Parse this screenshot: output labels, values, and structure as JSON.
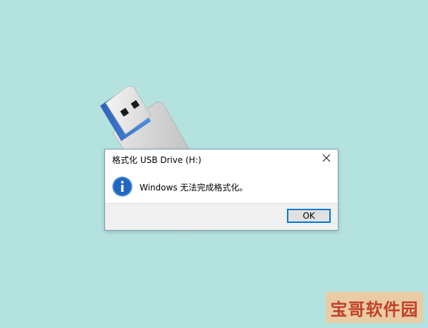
{
  "dialog": {
    "title": "格式化 USB Drive (H:)",
    "message": "Windows 无法完成格式化。",
    "ok_label": "OK",
    "icon": "info-icon",
    "close_icon": "close-icon"
  },
  "watermark": {
    "text": "宝哥软件园"
  },
  "colors": {
    "background": "#b4e3df",
    "usb_connector": "#3a72c9",
    "info_icon": "#1f66c2",
    "button_border": "#0078d7",
    "watermark_text": "#c2402a"
  }
}
